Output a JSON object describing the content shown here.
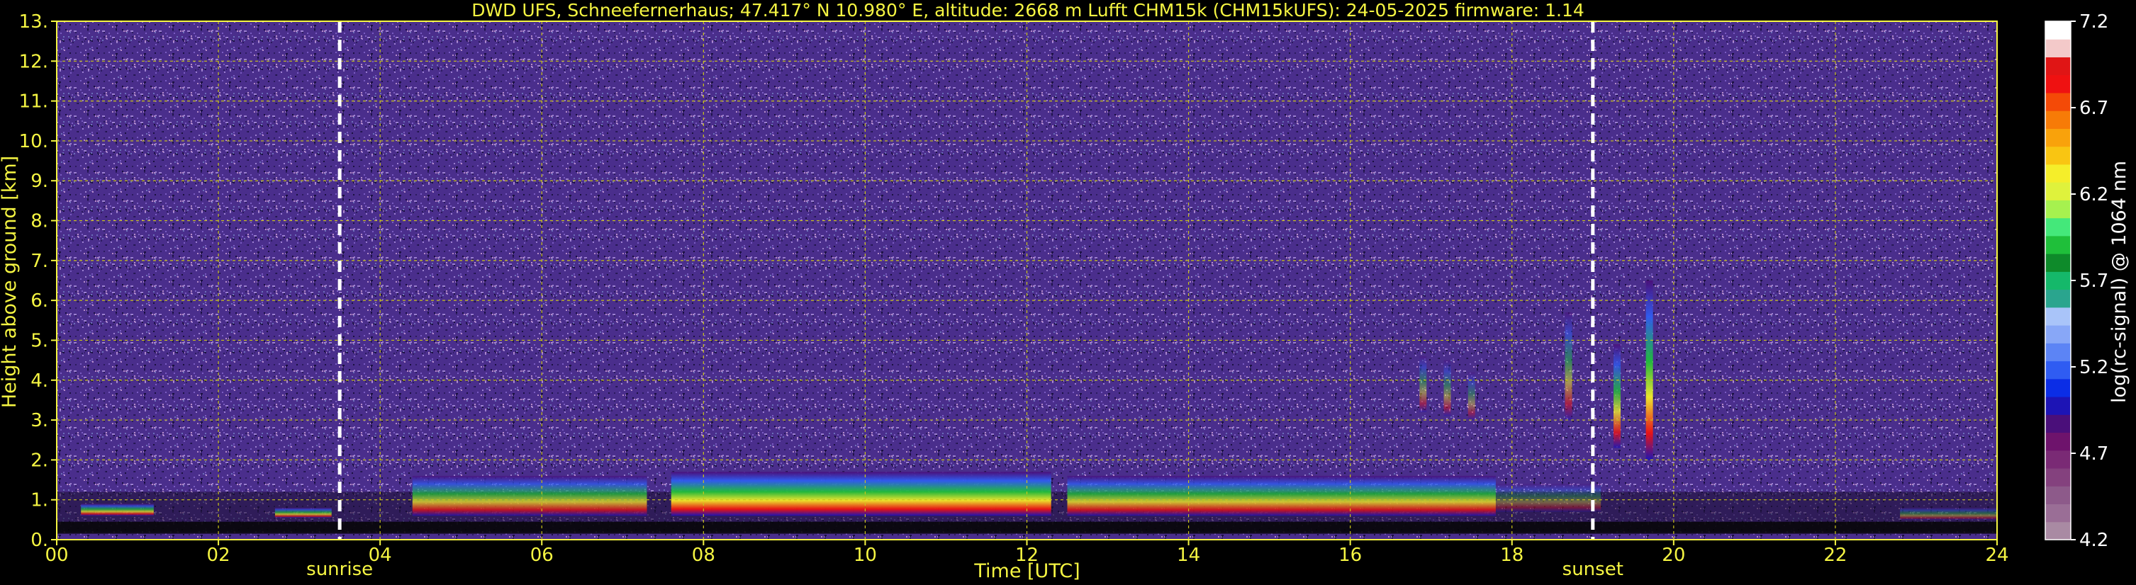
{
  "chart_data": {
    "type": "heatmap",
    "title": "DWD UFS, Schneefernerhaus; 47.417° N 10.980° E, altitude: 2668 m    Lufft CHM15k (CHM15kUFS): 24-05-2025    firmware: 1.14",
    "xlabel": "Time [UTC]",
    "ylabel": "Height above ground [km]",
    "xlim": [
      0,
      24
    ],
    "ylim": [
      0,
      13
    ],
    "x_ticks": [
      "00",
      "02",
      "04",
      "06",
      "08",
      "10",
      "12",
      "14",
      "16",
      "18",
      "20",
      "22",
      "24"
    ],
    "y_ticks": [
      "0.",
      "1.",
      "2.",
      "3.",
      "4.",
      "5.",
      "6.",
      "7.",
      "8.",
      "9.",
      "10.",
      "11.",
      "12.",
      "13."
    ],
    "grid": true,
    "sunrise": {
      "label": "sunrise",
      "time": 3.5
    },
    "sunset": {
      "label": "sunset",
      "time": 19.0
    },
    "colorbar": {
      "label": "log(rc-signal) @ 1064 nm",
      "range": [
        4.2,
        7.2
      ],
      "ticks": [
        "4.2",
        "4.7",
        "5.2",
        "5.7",
        "6.2",
        "6.7",
        "7.2"
      ],
      "colors": [
        "#a98aa3",
        "#9a6e96",
        "#8d5a8a",
        "#84417e",
        "#7a2a75",
        "#6e136c",
        "#4a0f7a",
        "#1d14b5",
        "#0b2de6",
        "#2f5cf2",
        "#5c84f5",
        "#88a7f7",
        "#a9c4f9",
        "#2aa58e",
        "#15b86a",
        "#0e8a2a",
        "#1fbf3a",
        "#44e87a",
        "#a6f14f",
        "#dff23c",
        "#f5ee2a",
        "#f9c512",
        "#f9a20b",
        "#f77b07",
        "#f44a07",
        "#ef1111",
        "#e01515",
        "#f3c9c9",
        "#ffffff"
      ]
    },
    "background_layer": {
      "color": "#4a2e8c"
    },
    "cloud_layers": [
      {
        "start": 0.3,
        "end": 1.2,
        "base_km": 0.6,
        "top_km": 0.9,
        "intensity": 0.75
      },
      {
        "start": 2.7,
        "end": 3.4,
        "base_km": 0.55,
        "top_km": 0.8,
        "intensity": 0.7
      },
      {
        "start": 4.4,
        "end": 7.3,
        "base_km": 0.6,
        "top_km": 1.6,
        "intensity": 0.75
      },
      {
        "start": 7.6,
        "end": 12.3,
        "base_km": 0.6,
        "top_km": 1.7,
        "intensity": 0.95
      },
      {
        "start": 12.5,
        "end": 17.8,
        "base_km": 0.6,
        "top_km": 1.6,
        "intensity": 0.8
      },
      {
        "start": 17.8,
        "end": 19.1,
        "base_km": 0.7,
        "top_km": 1.4,
        "intensity": 0.35
      },
      {
        "start": 22.8,
        "end": 24.0,
        "base_km": 0.5,
        "top_km": 0.8,
        "intensity": 0.4
      }
    ],
    "elevated_features": [
      {
        "time": 16.9,
        "base_km": 3.2,
        "top_km": 4.6,
        "intensity": 0.45
      },
      {
        "time": 17.2,
        "base_km": 3.1,
        "top_km": 4.5,
        "intensity": 0.45
      },
      {
        "time": 17.5,
        "base_km": 3.0,
        "top_km": 4.2,
        "intensity": 0.4
      },
      {
        "time": 18.7,
        "base_km": 3.0,
        "top_km": 5.7,
        "intensity": 0.55
      },
      {
        "time": 19.3,
        "base_km": 2.3,
        "top_km": 4.9,
        "intensity": 0.8
      },
      {
        "time": 19.7,
        "base_km": 2.0,
        "top_km": 6.5,
        "intensity": 0.95
      }
    ]
  }
}
